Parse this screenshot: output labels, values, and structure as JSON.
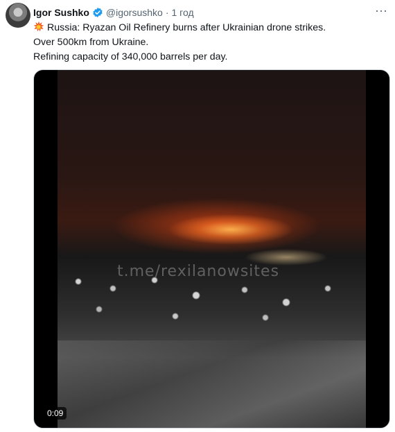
{
  "author": {
    "name": "Igor Sushko",
    "handle": "@igorsushko",
    "separator": "·",
    "time": "1 год",
    "verified_icon": "verified-badge-icon",
    "avatar_icon": "avatar-photo"
  },
  "more_menu": {
    "label": "···",
    "icon": "more-options-icon"
  },
  "tweet": {
    "emoji": "collision-emoji",
    "lines": [
      "Russia: Ryazan Oil Refinery burns after Ukrainian drone strikes.",
      "Over 500km from Ukraine.",
      "Refining capacity of 340,000 barrels per day."
    ]
  },
  "video": {
    "watermark": "t.me/rexilanowsites",
    "duration": "0:09"
  },
  "colors": {
    "text": "#0f1419",
    "muted": "#536471",
    "verified": "#1d9bf0",
    "border": "#cfd9de"
  }
}
